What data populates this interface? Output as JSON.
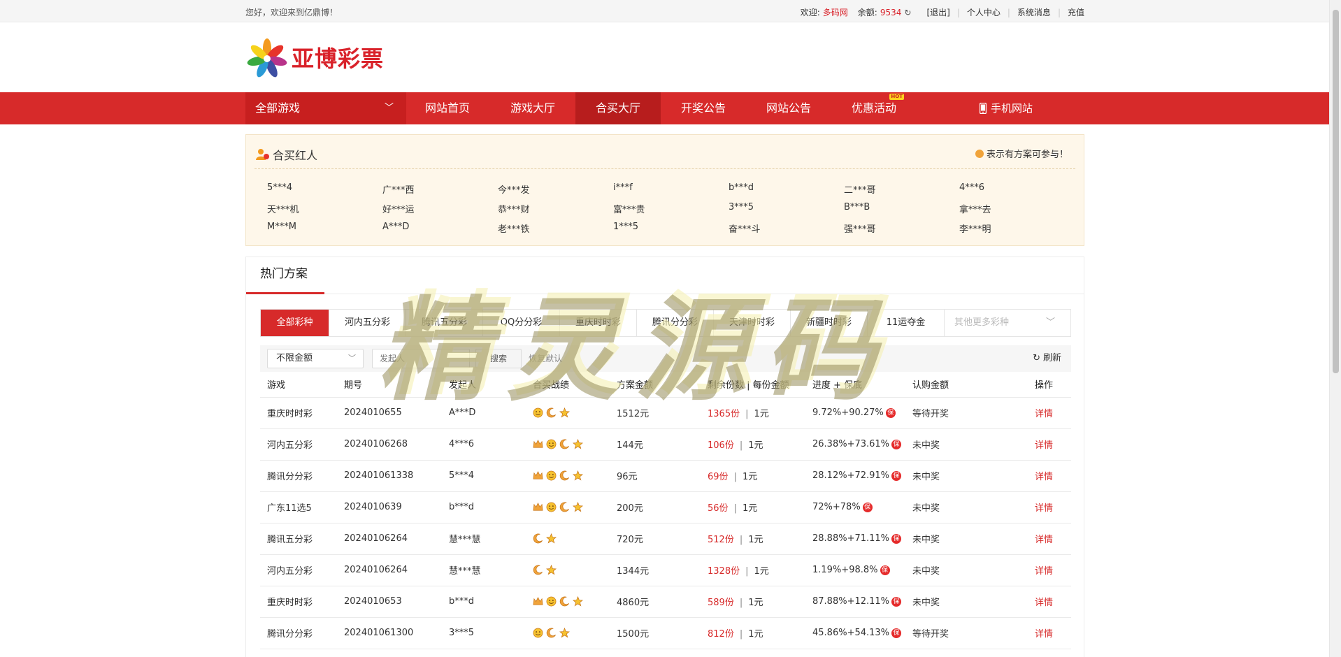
{
  "topbar": {
    "welcome": "您好，欢迎来到亿鼎博！",
    "greet_label": "欢迎:",
    "username": "多码网",
    "balance_label": "余额:",
    "balance": "9534",
    "logout": "[退出]",
    "user_center": "个人中心",
    "messages": "系统消息",
    "recharge": "充值"
  },
  "logo": {
    "text": "亚博彩票"
  },
  "nav": {
    "all_games": "全部游戏",
    "items": [
      "网站首页",
      "游戏大厅",
      "合买大厅",
      "开奖公告",
      "网站公告",
      "优惠活动"
    ],
    "hot_badge": "HOT",
    "mobile": "手机网站"
  },
  "panel": {
    "title": "合买红人",
    "hint": "表示有方案可参与！",
    "people": [
      "5***4",
      "广***西",
      "今***发",
      "i***f",
      "b***d",
      "二***哥",
      "4***6",
      "天***机",
      "好***运",
      "恭***财",
      "富***贵",
      "3***5",
      "B***B",
      "拿***去",
      "M***M",
      "A***D",
      "老***铁",
      "1***5",
      "奋***斗",
      "强***哥",
      "李***明"
    ]
  },
  "plans": {
    "tab": "热门方案",
    "lotteries": [
      "全部彩种",
      "河内五分彩",
      "腾讯五分彩",
      "QQ分分彩",
      "重庆时时彩",
      "腾讯分分彩",
      "天津时时彩",
      "新疆时时彩",
      "11运夺金"
    ],
    "more": "其他更多彩种",
    "filter": {
      "amount": "不限金额",
      "initiator_placeholder": "发起人",
      "search": "搜索",
      "reset": "恢复默认",
      "refresh": "刷新"
    },
    "columns": [
      "游戏",
      "期号",
      "发起人",
      "合买战绩",
      "方案金额",
      "剩余份数 | 每份金额",
      "进度 + 保底",
      "认购金额",
      "操作"
    ],
    "rows": [
      {
        "game": "重庆时时彩",
        "issue": "2024010655",
        "user": "A***D",
        "medals": [
          "face",
          "moon",
          "star"
        ],
        "amount": "1512元",
        "left": "1365份",
        "per": "1元",
        "progress": "9.72%+90.27%",
        "bao": "保",
        "status": "等待开奖",
        "op": "详情"
      },
      {
        "game": "河内五分彩",
        "issue": "20240106268",
        "user": "4***6",
        "medals": [
          "crown",
          "face",
          "moon",
          "star"
        ],
        "amount": "144元",
        "left": "106份",
        "per": "1元",
        "progress": "26.38%+73.61%",
        "bao": "保",
        "status": "未中奖",
        "op": "详情"
      },
      {
        "game": "腾讯分分彩",
        "issue": "202401061338",
        "user": "5***4",
        "medals": [
          "crown",
          "face",
          "moon",
          "star"
        ],
        "amount": "96元",
        "left": "69份",
        "per": "1元",
        "progress": "28.12%+72.91%",
        "bao": "保",
        "status": "未中奖",
        "op": "详情"
      },
      {
        "game": "广东11选5",
        "issue": "2024010639",
        "user": "b***d",
        "medals": [
          "crown",
          "face",
          "moon",
          "star"
        ],
        "amount": "200元",
        "left": "56份",
        "per": "1元",
        "progress": "72%+78%",
        "bao": "保",
        "status": "未中奖",
        "op": "详情"
      },
      {
        "game": "腾讯五分彩",
        "issue": "20240106264",
        "user": "慧***慧",
        "medals": [
          "moon",
          "star"
        ],
        "amount": "720元",
        "left": "512份",
        "per": "1元",
        "progress": "28.88%+71.11%",
        "bao": "保",
        "status": "未中奖",
        "op": "详情"
      },
      {
        "game": "河内五分彩",
        "issue": "20240106264",
        "user": "慧***慧",
        "medals": [
          "moon",
          "star"
        ],
        "amount": "1344元",
        "left": "1328份",
        "per": "1元",
        "progress": "1.19%+98.8%",
        "bao": "保",
        "status": "未中奖",
        "op": "详情"
      },
      {
        "game": "重庆时时彩",
        "issue": "2024010653",
        "user": "b***d",
        "medals": [
          "crown",
          "face",
          "moon",
          "star"
        ],
        "amount": "4860元",
        "left": "589份",
        "per": "1元",
        "progress": "87.88%+12.11%",
        "bao": "保",
        "status": "未中奖",
        "op": "详情"
      },
      {
        "game": "腾讯分分彩",
        "issue": "202401061300",
        "user": "3***5",
        "medals": [
          "face",
          "moon",
          "star"
        ],
        "amount": "1500元",
        "left": "812份",
        "per": "1元",
        "progress": "45.86%+54.13%",
        "bao": "保",
        "status": "等待开奖",
        "op": "详情"
      }
    ]
  },
  "watermark": "精灵源码",
  "colors": {
    "brand_red": "#d72a2a",
    "nav_dark": "#c71f1f",
    "panel_bg": "#fef7ea",
    "medal_gold": "#f0a33a"
  }
}
